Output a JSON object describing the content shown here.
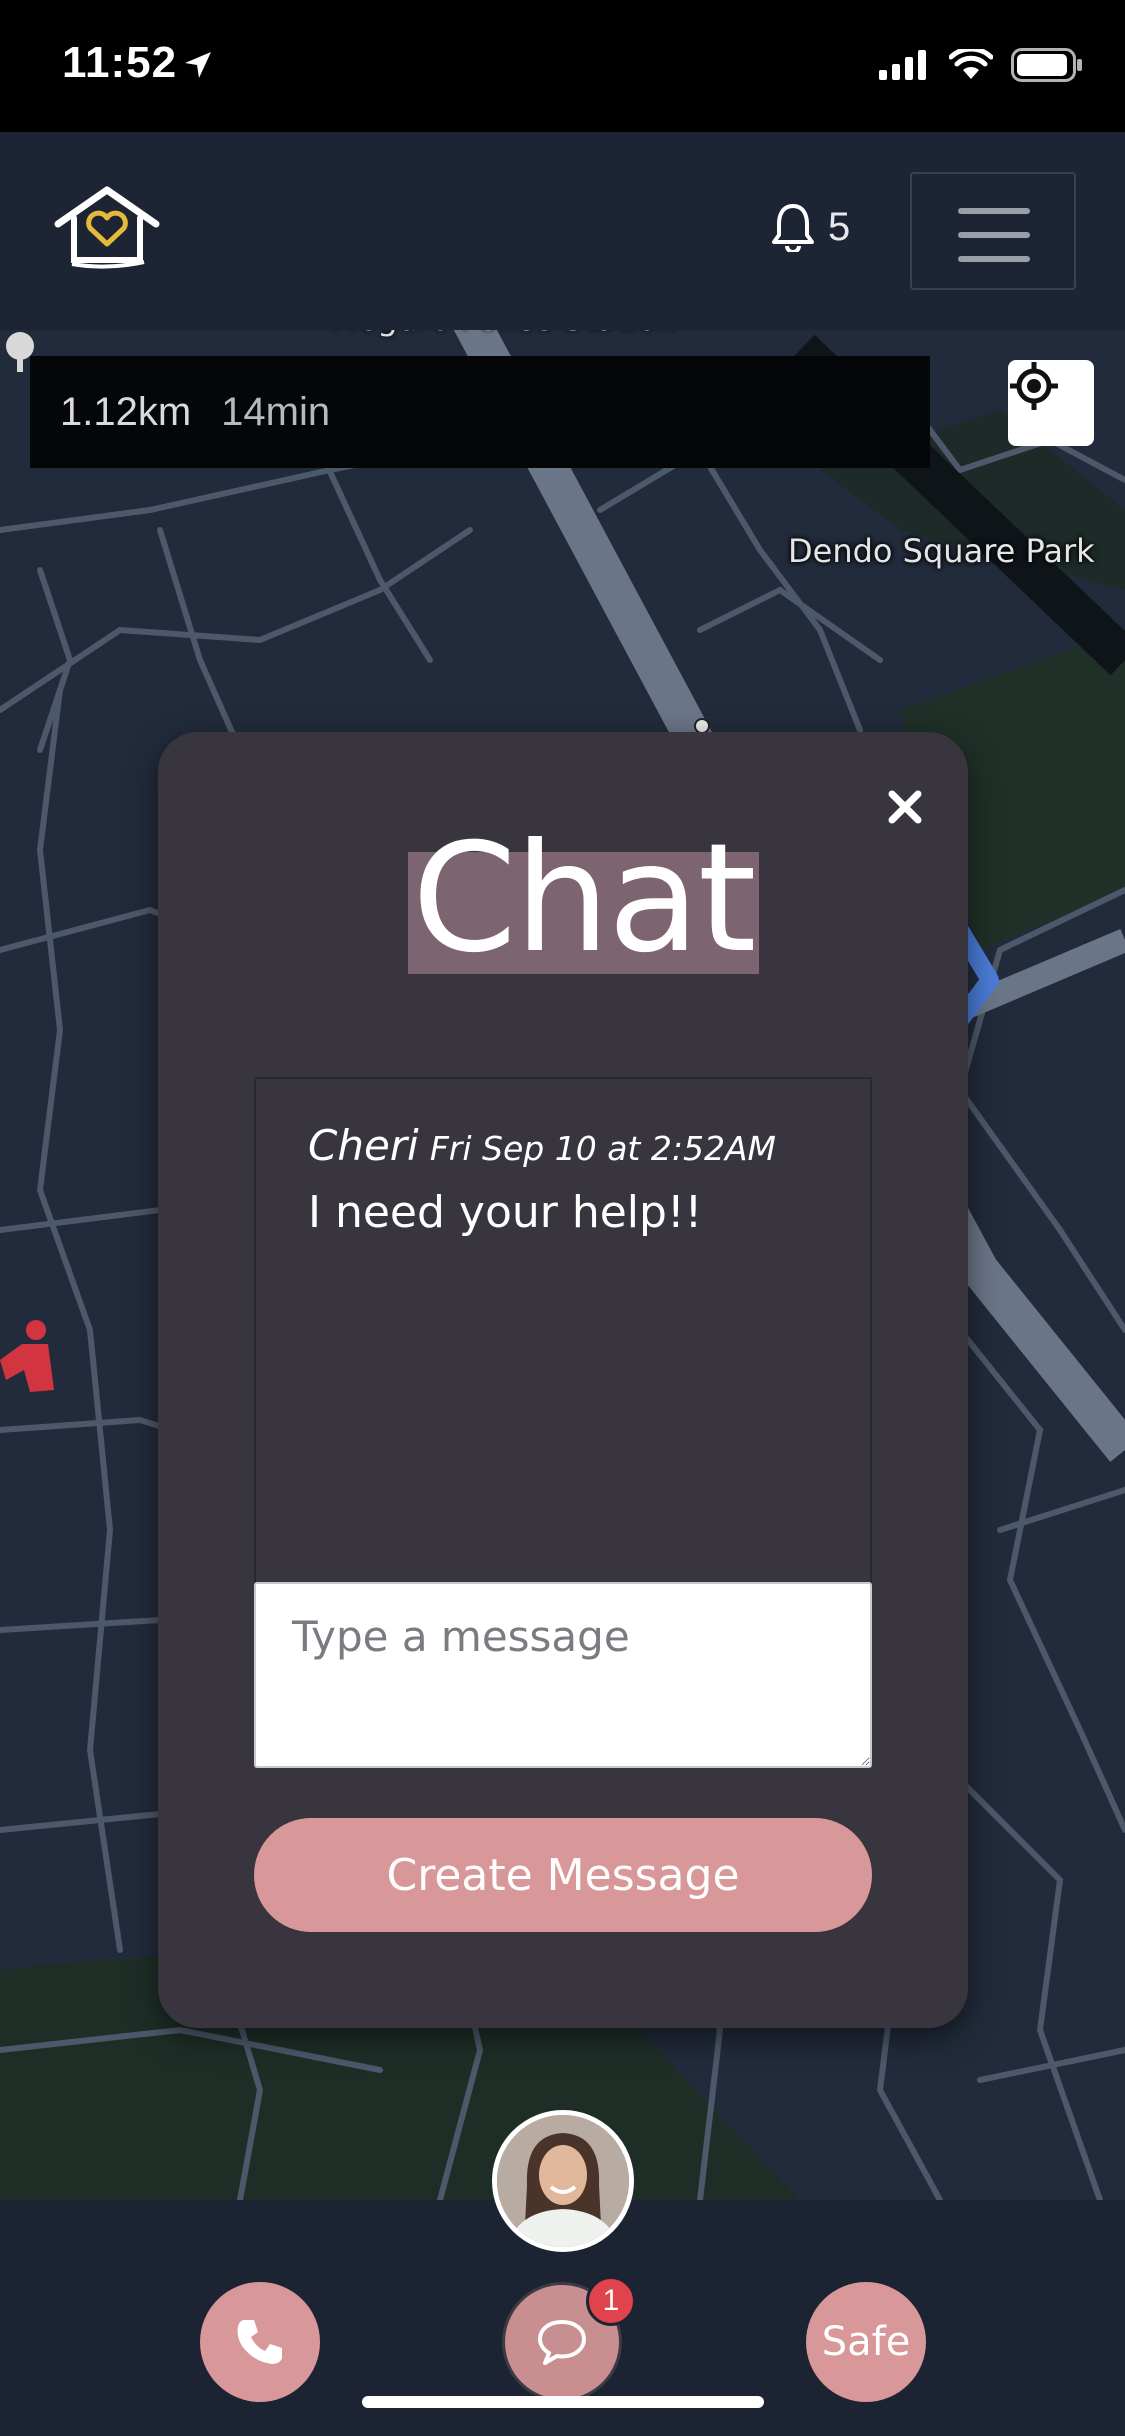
{
  "status_bar": {
    "time": "11:52"
  },
  "header": {
    "notification_count": "5"
  },
  "map": {
    "route_distance": "1.12km",
    "route_time": "14min",
    "park_label": "Dendo Square Park",
    "top_label": "Meguro Police Station"
  },
  "chat": {
    "title": "Chat",
    "messages": [
      {
        "sender": "Cheri",
        "timestamp": "Fri Sep 10 at 2:52AM",
        "text": "I need your help!!"
      }
    ],
    "input_placeholder": "Type a message",
    "submit_label": "Create Message"
  },
  "nav": {
    "chat_badge": "1",
    "safe_label": "Safe"
  },
  "colors": {
    "accent_pink": "#d89799",
    "modal_bg": "#38353f",
    "title_highlight": "#7c6470",
    "header_bg": "#1d2433",
    "badge_red": "#e0434b"
  }
}
